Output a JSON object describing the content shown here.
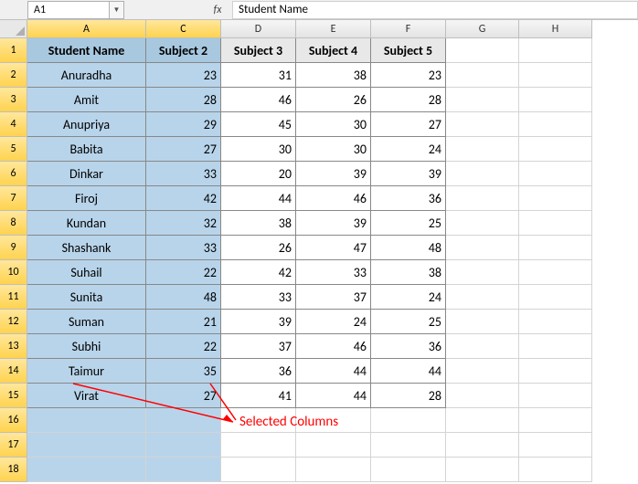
{
  "formula_bar": {
    "name_box": "A1",
    "fx": "fx",
    "formula": "Student Name"
  },
  "col_labels": [
    "A",
    "C",
    "D",
    "E",
    "F",
    "G",
    "H"
  ],
  "selected_cols": [
    "A",
    "C"
  ],
  "headers": {
    "a": "Student Name",
    "c": "Subject 2",
    "d": "Subject 3",
    "e": "Subject 4",
    "f": "Subject 5"
  },
  "rows": [
    {
      "name": "Anuradha",
      "c": 23,
      "d": 31,
      "e": 38,
      "f": 23
    },
    {
      "name": "Amit",
      "c": 28,
      "d": 46,
      "e": 26,
      "f": 28
    },
    {
      "name": "Anupriya",
      "c": 29,
      "d": 45,
      "e": 30,
      "f": 27
    },
    {
      "name": "Babita",
      "c": 27,
      "d": 30,
      "e": 30,
      "f": 24
    },
    {
      "name": "Dinkar",
      "c": 33,
      "d": 20,
      "e": 39,
      "f": 39
    },
    {
      "name": "Firoj",
      "c": 42,
      "d": 44,
      "e": 46,
      "f": 36
    },
    {
      "name": "Kundan",
      "c": 32,
      "d": 38,
      "e": 39,
      "f": 25
    },
    {
      "name": "Shashank",
      "c": 33,
      "d": 26,
      "e": 47,
      "f": 48
    },
    {
      "name": "Suhail",
      "c": 22,
      "d": 42,
      "e": 33,
      "f": 38
    },
    {
      "name": "Sunita",
      "c": 48,
      "d": 33,
      "e": 37,
      "f": 24
    },
    {
      "name": "Suman",
      "c": 21,
      "d": 39,
      "e": 24,
      "f": 25
    },
    {
      "name": "Subhi",
      "c": 22,
      "d": 37,
      "e": 46,
      "f": 36
    },
    {
      "name": "Taimur",
      "c": 35,
      "d": 36,
      "e": 44,
      "f": 44
    },
    {
      "name": "Virat",
      "c": 27,
      "d": 41,
      "e": 44,
      "f": 28
    }
  ],
  "annotation": "Selected Columns",
  "chart_data": {
    "type": "table",
    "title": "Student subject scores",
    "columns": [
      "Student Name",
      "Subject 2",
      "Subject 3",
      "Subject 4",
      "Subject 5"
    ],
    "data": [
      [
        "Anuradha",
        23,
        31,
        38,
        23
      ],
      [
        "Amit",
        28,
        46,
        26,
        28
      ],
      [
        "Anupriya",
        29,
        45,
        30,
        27
      ],
      [
        "Babita",
        27,
        30,
        30,
        24
      ],
      [
        "Dinkar",
        33,
        20,
        39,
        39
      ],
      [
        "Firoj",
        42,
        44,
        46,
        36
      ],
      [
        "Kundan",
        32,
        38,
        39,
        25
      ],
      [
        "Shashank",
        33,
        26,
        47,
        48
      ],
      [
        "Suhail",
        22,
        42,
        33,
        38
      ],
      [
        "Sunita",
        48,
        33,
        37,
        24
      ],
      [
        "Suman",
        21,
        39,
        24,
        25
      ],
      [
        "Subhi",
        22,
        37,
        46,
        36
      ],
      [
        "Taimur",
        35,
        36,
        44,
        44
      ],
      [
        "Virat",
        27,
        41,
        44,
        28
      ]
    ]
  }
}
